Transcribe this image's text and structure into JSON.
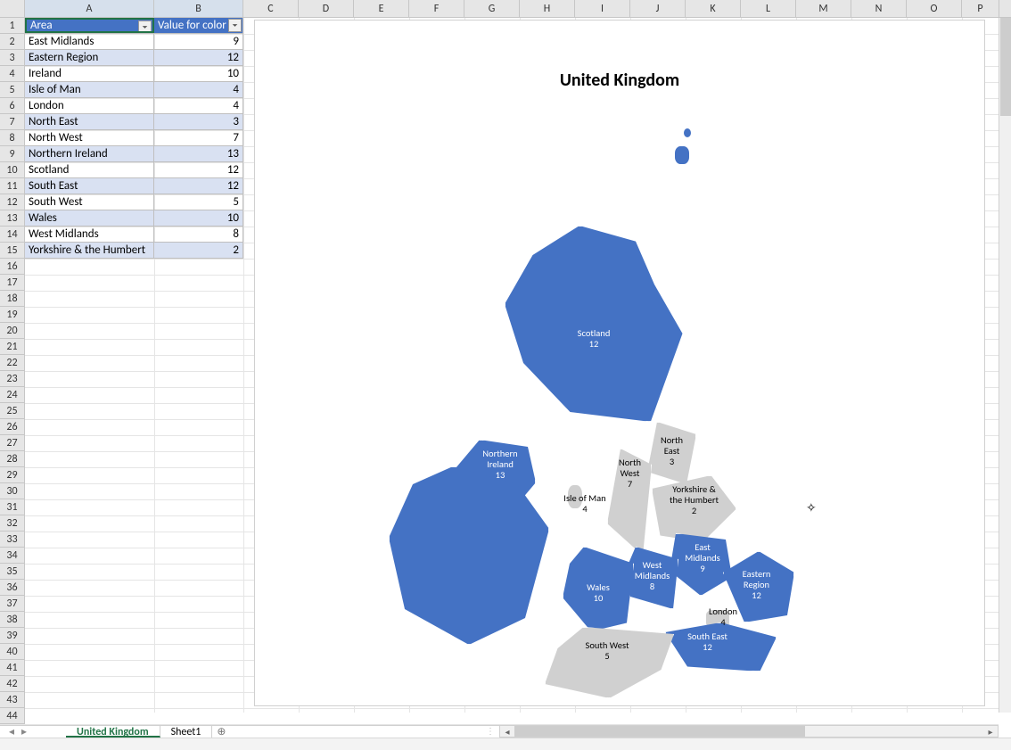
{
  "columns": [
    "A",
    "B",
    "C",
    "D",
    "E",
    "F",
    "G",
    "H",
    "I",
    "J",
    "K",
    "L",
    "M",
    "N",
    "O",
    "P"
  ],
  "row_count": 44,
  "table": {
    "headers": {
      "area": "Area",
      "value": "Value for color"
    },
    "rows": [
      {
        "area": "East Midlands",
        "value": "9"
      },
      {
        "area": "Eastern Region",
        "value": "12"
      },
      {
        "area": "Ireland",
        "value": "10"
      },
      {
        "area": "Isle of Man",
        "value": "4"
      },
      {
        "area": "London",
        "value": "4"
      },
      {
        "area": "North East",
        "value": "3"
      },
      {
        "area": "North West",
        "value": "7"
      },
      {
        "area": "Northern Ireland",
        "value": "13"
      },
      {
        "area": "Scotland",
        "value": "12"
      },
      {
        "area": "South East",
        "value": "12"
      },
      {
        "area": "South West",
        "value": "5"
      },
      {
        "area": "Wales",
        "value": "10"
      },
      {
        "area": "West Midlands",
        "value": "8"
      },
      {
        "area": "Yorkshire & the Humbert",
        "value": "2"
      }
    ]
  },
  "chart": {
    "title": "United Kingdom"
  },
  "chart_data": {
    "type": "map",
    "title": "United Kingdom",
    "regions": [
      {
        "name": "East Midlands",
        "value": 9
      },
      {
        "name": "Eastern Region",
        "value": 12
      },
      {
        "name": "Ireland",
        "value": 10
      },
      {
        "name": "Isle of Man",
        "value": 4
      },
      {
        "name": "London",
        "value": 4
      },
      {
        "name": "North East",
        "value": 3
      },
      {
        "name": "North West",
        "value": 7
      },
      {
        "name": "Northern Ireland",
        "value": 13
      },
      {
        "name": "Scotland",
        "value": 12
      },
      {
        "name": "South East",
        "value": 12
      },
      {
        "name": "South West",
        "value": 5
      },
      {
        "name": "Wales",
        "value": 10
      },
      {
        "name": "West Midlands",
        "value": 8
      },
      {
        "name": "Yorkshire & the Humbert",
        "value": 2
      }
    ]
  },
  "map_labels": {
    "scotland": "Scotland\n12",
    "nireland": "Northern\nIreland\n13",
    "northeast": "North\nEast\n3",
    "northwest": "North\nWest\n7",
    "yorkshire": "Yorkshire &\nthe Humbert\n2",
    "isleofman": "Isle of Man\n4",
    "eastmidlands": "East\nMidlands\n9",
    "westmidlands": "West\nMidlands\n8",
    "eastern": "Eastern\nRegion\n12",
    "wales": "Wales\n10",
    "london": "London\n4",
    "southeast": "South East\n12",
    "southwest": "South West\n5"
  },
  "tabs": {
    "active": "United Kingdom",
    "other": "Sheet1"
  }
}
